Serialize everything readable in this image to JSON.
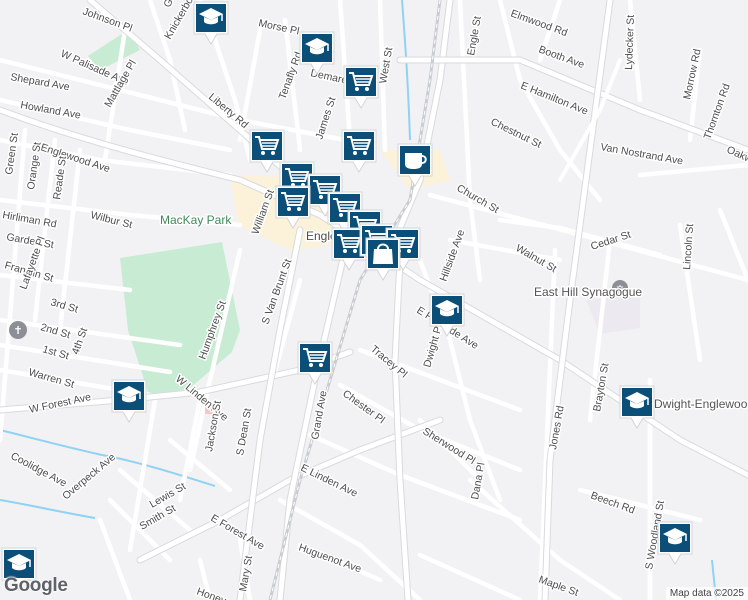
{
  "map": {
    "provider_logo": "Google",
    "attribution": "Map data ©2025",
    "places": [
      {
        "name": "MacKay Park",
        "kind": "park"
      },
      {
        "name": "East Hill Synagogue",
        "kind": "worship"
      },
      {
        "name": "Dwight-Englewood School",
        "kind": "school"
      },
      {
        "name": "Englewood",
        "kind": "city"
      }
    ],
    "streets": [
      "Morse Pl",
      "Demarest Ave",
      "West St",
      "Booth Ave",
      "E Hamilton Ave",
      "Chestnut St",
      "Lydecker St",
      "Morrow Rd",
      "Thornton Rd",
      "Oakwood",
      "W Palisade Ave",
      "Knickerbocker",
      "Liberty Rd",
      "Tenafly Rd",
      "James St",
      "Engle St",
      "Church St",
      "Walnut St",
      "Cedar St",
      "Lincoln St",
      "Shepard Ave",
      "Howland Ave",
      "Mattlage Pl",
      "Englewood Ave",
      "Green St",
      "Orange St",
      "Reade St",
      "Hirliman Rd",
      "Wilbur St",
      "Garden St",
      "William St",
      "Franklin St",
      "Lafayette Pl",
      "3rd St",
      "2nd St",
      "1st St",
      "4th St",
      "Warren St",
      "Humphrey St",
      "S Van Brunt St",
      "W Linden Ave",
      "S Dean St",
      "Grand Ave",
      "E Palisade Ave",
      "Hillside Ave",
      "Dwight Pl",
      "Tracey Pl",
      "Chester Pl",
      "Sherwood Pl",
      "Jones Rd",
      "Brayton St",
      "Beech Rd",
      "E Linden Ave",
      "Dana Pl",
      "W Forest Ave",
      "Coolidge Ave",
      "Overpeck Ave",
      "Jackson St",
      "Lewis St",
      "Smith St",
      "E Forest Ave",
      "Mary St",
      "Huguenot Ave",
      "Maple St",
      "S Woodland St",
      "Van Nostrand Ave",
      "Glen",
      "Johnson Pl",
      "Elmwood Rd",
      "Honey",
      "Grand Ave"
    ]
  }
}
